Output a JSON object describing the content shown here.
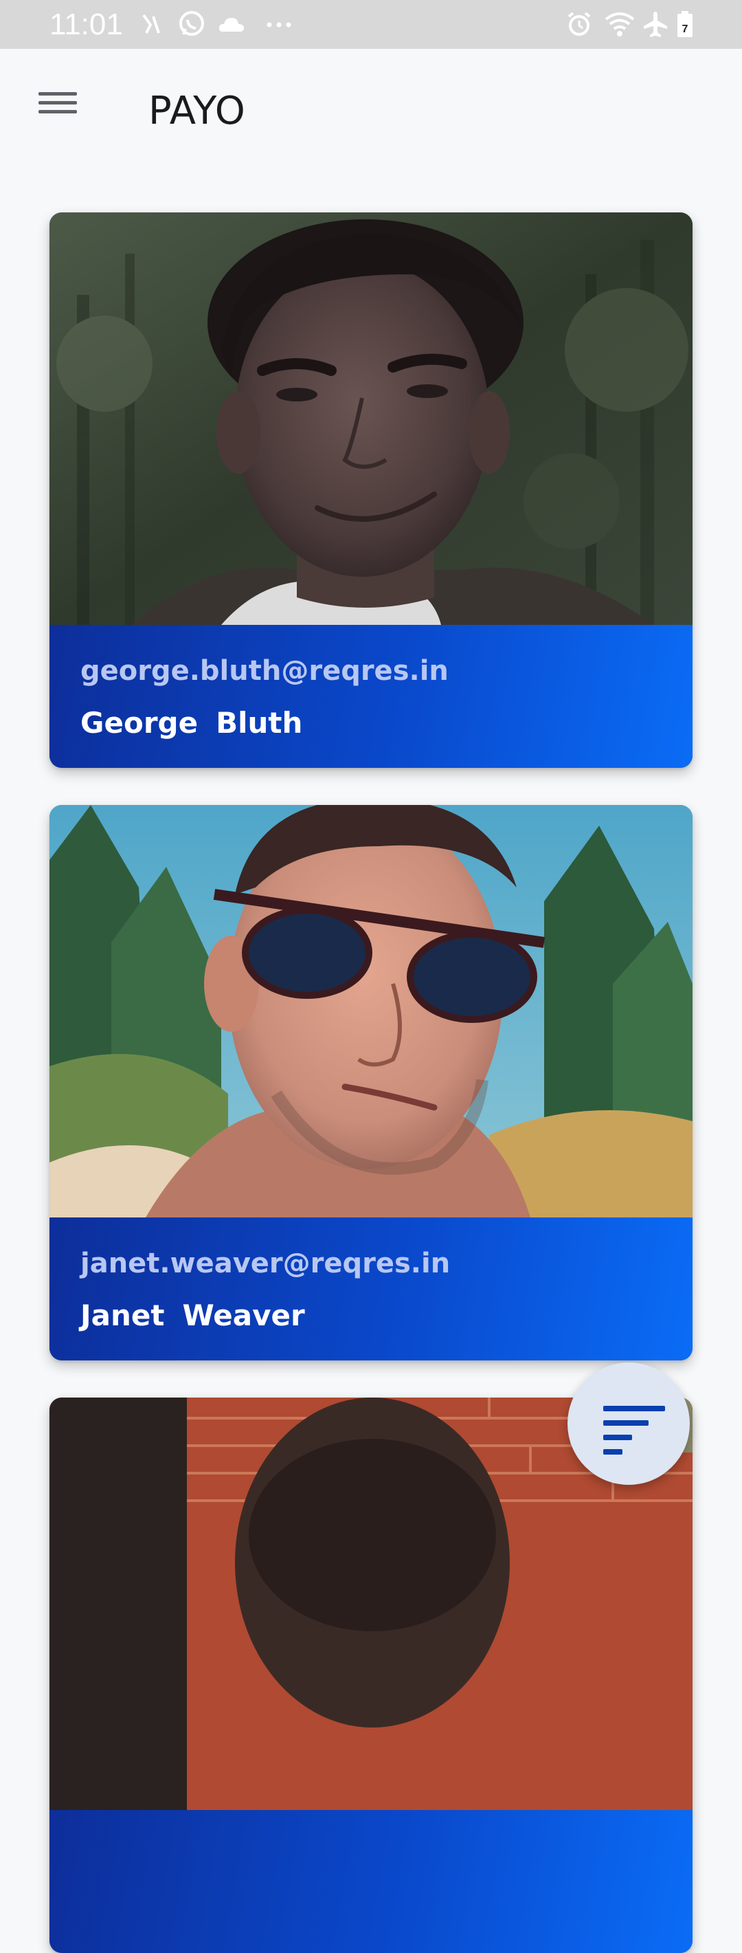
{
  "status_bar": {
    "time": "11:01",
    "left_icons": [
      "nfc-slash-icon",
      "whatsapp-icon",
      "cloud-icon",
      "more-dots-icon"
    ],
    "right_icons": [
      "alarm-icon",
      "wifi-icon",
      "airplane-icon",
      "battery-icon"
    ],
    "battery_level": "7"
  },
  "app_bar": {
    "title": "PAYO",
    "menu_icon": "hamburger-menu-icon"
  },
  "users": [
    {
      "email": "george.bluth@reqres.in",
      "first_name": "George",
      "last_name": "Bluth"
    },
    {
      "email": "janet.weaver@reqres.in",
      "first_name": "Janet",
      "last_name": "Weaver"
    },
    {
      "email": "",
      "first_name": "",
      "last_name": ""
    }
  ],
  "fab": {
    "icon": "filter-sort-icon"
  },
  "colors": {
    "card_gradient_start": "#0d2e9a",
    "card_gradient_end": "#0a6cf6",
    "email_text": "#b8c7f2",
    "fab_background": "#dde6f2",
    "fab_icon": "#0a3fb0"
  }
}
